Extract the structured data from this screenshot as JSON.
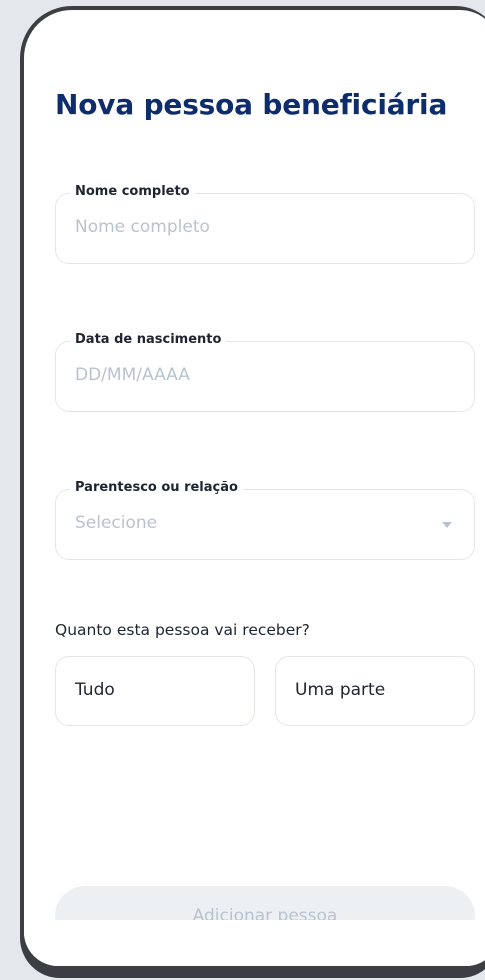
{
  "page": {
    "title": "Nova pessoa beneficiária"
  },
  "form": {
    "full_name": {
      "label": "Nome completo",
      "placeholder": "Nome completo"
    },
    "birth_date": {
      "label": "Data de nascimento",
      "placeholder": "DD/MM/AAAA"
    },
    "relationship": {
      "label": "Parentesco ou relação",
      "placeholder": "Selecione"
    },
    "share_question": "Quanto esta pessoa vai receber?",
    "share_options": [
      "Tudo",
      "Uma parte"
    ],
    "submit_label": "Adicionar pessoa"
  },
  "colors": {
    "title": "#0d2d6c",
    "placeholder": "#b9c3cf",
    "border": "#e2e6ea",
    "disabled_button": "#edf0f3"
  },
  "icons": {
    "relationship_dropdown": "chevron-down-icon"
  }
}
